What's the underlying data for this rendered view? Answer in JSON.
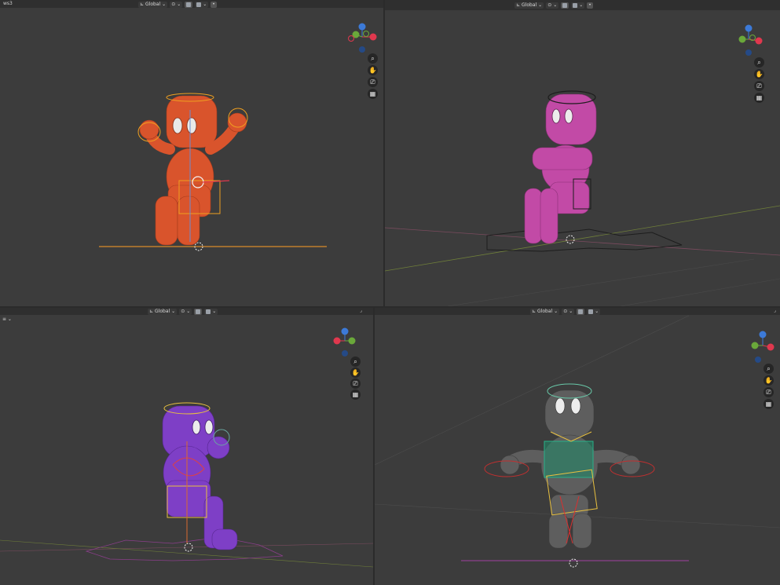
{
  "corner_label_tl": "ws3",
  "corner_label_bl": "≡ ⌄",
  "toolbar": {
    "orientation": "Global"
  },
  "colors": {
    "viewport_bg": "#3c3c3c",
    "header_bg": "#2f2f2f",
    "orange_character": "#d9542c",
    "pink_character": "#c24aa6",
    "purple_character": "#7e3fc6",
    "gray_character": "#5e5e5e",
    "axis_x": "#e0384e",
    "axis_y": "#6aa83a",
    "axis_z": "#3c7ad8"
  },
  "nav_icons": [
    "zoom-icon",
    "hand-pan-icon",
    "camera-view-icon",
    "grid-ortho-icon"
  ],
  "viewports": [
    {
      "name": "top-left",
      "character": "orange"
    },
    {
      "name": "top-right",
      "character": "pink"
    },
    {
      "name": "bottom-left",
      "character": "purple"
    },
    {
      "name": "bottom-right",
      "character": "gray"
    }
  ]
}
